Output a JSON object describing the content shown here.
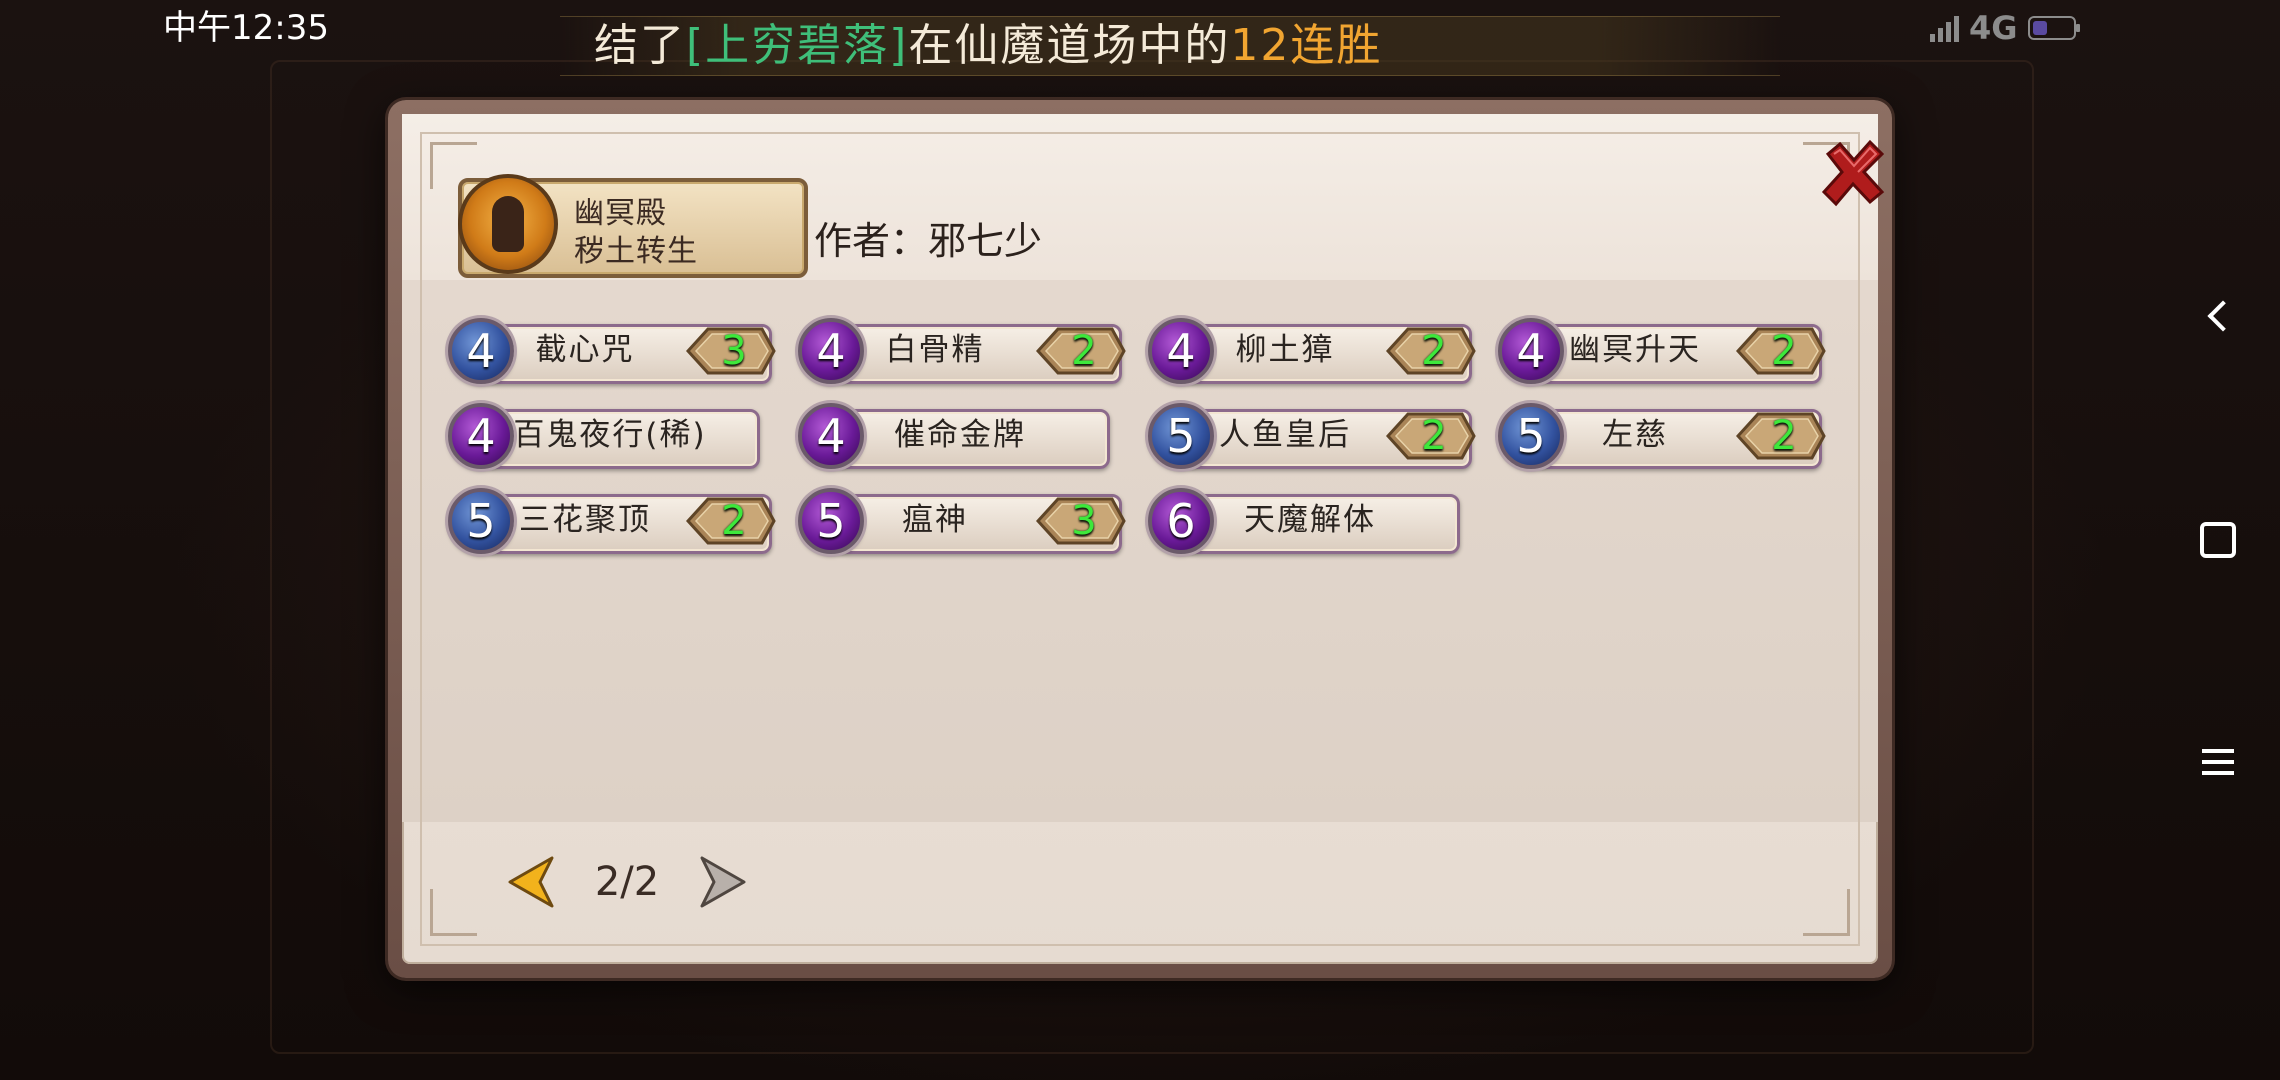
{
  "status_bar": {
    "time": "中午12:35",
    "network": "4G"
  },
  "ticker": {
    "prefix": "结了",
    "player_name": "[上穷碧落]",
    "middle": "在仙魔道场中的",
    "streak": "12连胜"
  },
  "dialog": {
    "faction": {
      "line1": "幽冥殿",
      "line2": "秽土转生"
    },
    "author": "作者：邪七少",
    "cards": [
      {
        "cost": "4",
        "name": "截心咒",
        "count": "3",
        "orb": "blue"
      },
      {
        "cost": "4",
        "name": "白骨精",
        "count": "2",
        "orb": "purple"
      },
      {
        "cost": "4",
        "name": "柳土獐",
        "count": "2",
        "orb": "purple"
      },
      {
        "cost": "4",
        "name": "幽冥升天",
        "count": "2",
        "orb": "purple"
      },
      {
        "cost": "4",
        "name": "百鬼夜行(稀)",
        "count": "",
        "orb": "purple"
      },
      {
        "cost": "4",
        "name": "催命金牌",
        "count": "",
        "orb": "purple"
      },
      {
        "cost": "5",
        "name": "人鱼皇后",
        "count": "2",
        "orb": "blue"
      },
      {
        "cost": "5",
        "name": "左慈",
        "count": "2",
        "orb": "blue"
      },
      {
        "cost": "5",
        "name": "三花聚顶",
        "count": "2",
        "orb": "blue"
      },
      {
        "cost": "5",
        "name": "瘟神",
        "count": "3",
        "orb": "purple"
      },
      {
        "cost": "6",
        "name": "天魔解体",
        "count": "",
        "orb": "purple"
      }
    ],
    "pagination": {
      "current": 2,
      "total": 2,
      "label": "2/2"
    }
  },
  "colors": {
    "count_green": "#3de83b",
    "player_name": "#3fbf7a",
    "streak": "#f1a531",
    "orb_purple": "#7a24a8",
    "orb_blue": "#3a5aa8"
  }
}
